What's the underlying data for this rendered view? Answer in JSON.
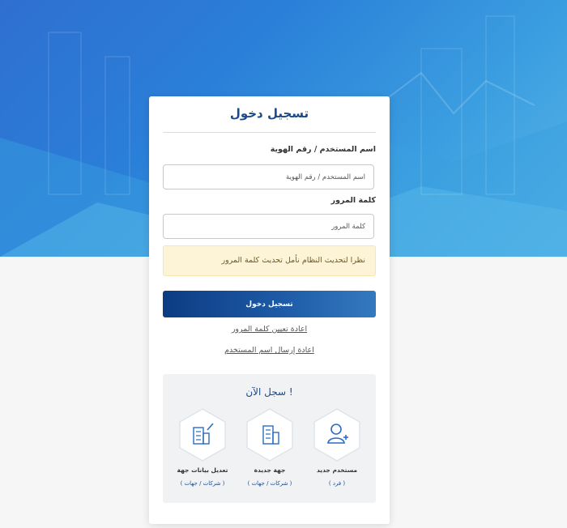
{
  "login": {
    "title": "تسجيل دخول",
    "username_label": "اسم المستخدم / رقم الهوية",
    "username_placeholder": "اسم المستخدم / رقم الهوية",
    "password_label": "كلمة المرور",
    "password_placeholder": "كلمة المرور",
    "notice": "نظرا لتحديث النظام نأمل تحديث كلمة المرور",
    "submit_label": "تسجيل دخول",
    "reset_password_link": "اعادة تعيين كلمة المرور",
    "resend_username_link": "اعادة إرسال اسم المستخدم"
  },
  "register": {
    "title": "سجل الآن !",
    "options": [
      {
        "label": "مستخدم جديد",
        "sub": "( فرد )",
        "icon": "add-user-icon"
      },
      {
        "label": "جهة جديدة",
        "sub": "( شركات / جهات )",
        "icon": "building-icon"
      },
      {
        "label": "تعديل بيانات جهة",
        "sub": "( شركات / جهات )",
        "icon": "building-edit-icon"
      }
    ]
  },
  "colors": {
    "primary": "#1c4a8a",
    "button_start": "#0c3c82",
    "button_end": "#3479c0",
    "notice_bg": "#fdf4d7",
    "hero": "#2a7fd8"
  }
}
